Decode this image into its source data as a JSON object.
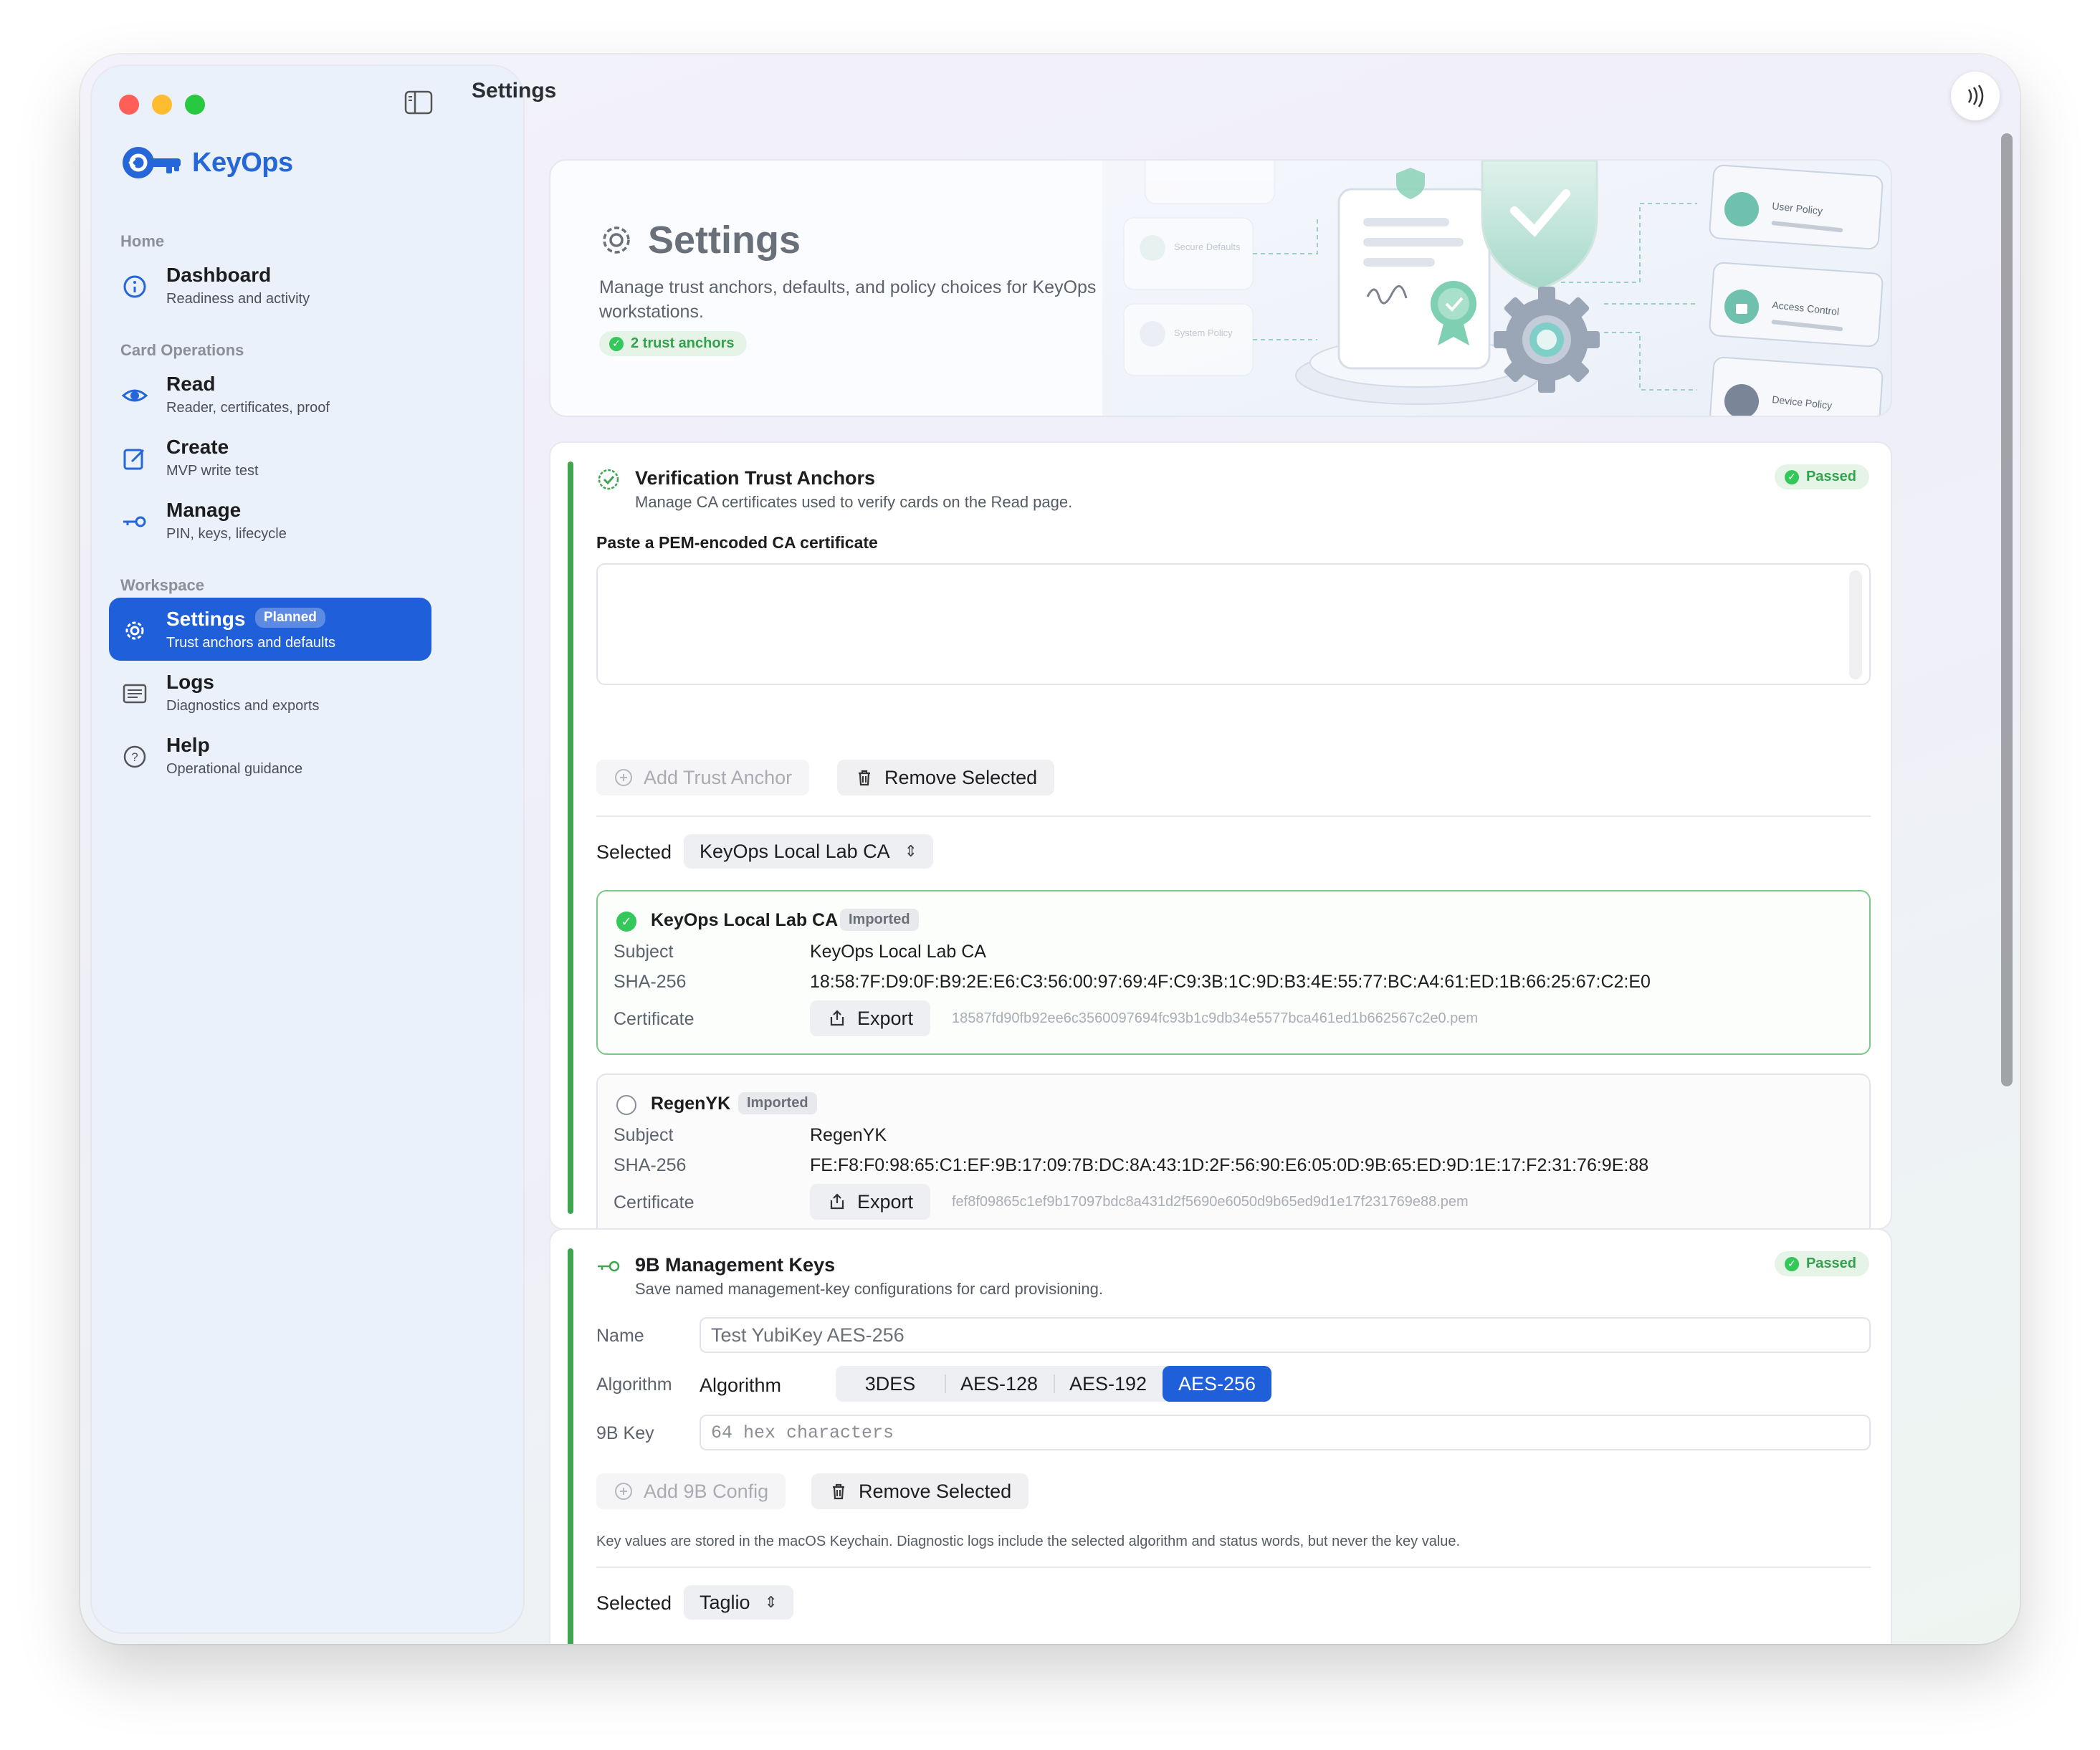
{
  "window": {
    "toolbar_title": "Settings"
  },
  "sidebar": {
    "brand": "KeyOps",
    "sections": [
      {
        "label": "Home"
      },
      {
        "label": "Card Operations"
      },
      {
        "label": "Workspace"
      }
    ],
    "items": [
      {
        "title": "Dashboard",
        "subtitle": "Readiness and activity",
        "icon": "dashboard-icon"
      },
      {
        "title": "Read",
        "subtitle": "Reader, certificates, proof",
        "icon": "eye-icon"
      },
      {
        "title": "Create",
        "subtitle": "MVP write test",
        "icon": "edit-icon"
      },
      {
        "title": "Manage",
        "subtitle": "PIN, keys, lifecycle",
        "icon": "key-icon"
      },
      {
        "title": "Settings",
        "subtitle": "Trust anchors and defaults",
        "badge": "Planned",
        "icon": "gear-icon",
        "active": true
      },
      {
        "title": "Logs",
        "subtitle": "Diagnostics and exports",
        "icon": "list-icon"
      },
      {
        "title": "Help",
        "subtitle": "Operational guidance",
        "icon": "help-icon"
      }
    ]
  },
  "hero": {
    "title": "Settings",
    "subtitle": "Manage trust anchors, defaults, and policy choices for KeyOps workstations.",
    "pill": "2 trust anchors",
    "art_labels": [
      "Secure Defaults",
      "System Policy",
      "User Policy",
      "Access Control",
      "Device Policy"
    ]
  },
  "trust_anchors": {
    "title": "Verification Trust Anchors",
    "subtitle": "Manage CA certificates used to verify cards on the Read page.",
    "status": "Passed",
    "paste_label": "Paste a PEM-encoded CA certificate",
    "add_button": "Add Trust Anchor",
    "remove_button": "Remove Selected",
    "selected_label": "Selected",
    "selected_value": "KeyOps Local Lab CA",
    "certs": [
      {
        "name": "KeyOps Local Lab CA",
        "badge": "Imported",
        "subject_label": "Subject",
        "subject": "KeyOps Local Lab CA",
        "sha_label": "SHA-256",
        "sha": "18:58:7F:D9:0F:B9:2E:E6:C3:56:00:97:69:4F:C9:3B:1C:9D:B3:4E:55:77:BC:A4:61:ED:1B:66:25:67:C2:E0",
        "cert_label": "Certificate",
        "export": "Export",
        "filename": "18587fd90fb92ee6c3560097694fc93b1c9db34e5577bca461ed1b662567c2e0.pem"
      },
      {
        "name": "RegenYK",
        "badge": "Imported",
        "subject_label": "Subject",
        "subject": "RegenYK",
        "sha_label": "SHA-256",
        "sha": "FE:F8:F0:98:65:C1:EF:9B:17:09:7B:DC:8A:43:1D:2F:56:90:E6:05:0D:9B:65:ED:9D:1E:17:F2:31:76:9E:88",
        "cert_label": "Certificate",
        "export": "Export",
        "filename": "fef8f09865c1ef9b17097bdc8a431d2f5690e6050d9b65ed9d1e17f231769e88.pem"
      }
    ]
  },
  "mgmt_keys": {
    "title": "9B Management Keys",
    "subtitle": "Save named management-key configurations for card provisioning.",
    "status": "Passed",
    "name_label": "Name",
    "name_placeholder": "Test YubiKey AES-256",
    "algorithm_label": "Algorithm",
    "algorithm_inline": "Algorithm",
    "algorithms": [
      "3DES",
      "AES-128",
      "AES-192",
      "AES-256"
    ],
    "key_label": "9B Key",
    "key_placeholder": "64 hex characters",
    "add_button": "Add 9B Config",
    "remove_button": "Remove Selected",
    "note": "Key values are stored in the macOS Keychain. Diagnostic logs include the selected algorithm and status words, but never the key value.",
    "selected_label": "Selected",
    "selected_value": "Taglio"
  },
  "colors": {
    "accent": "#1f5fd9",
    "success": "#34c759",
    "brand": "#2566d9"
  }
}
